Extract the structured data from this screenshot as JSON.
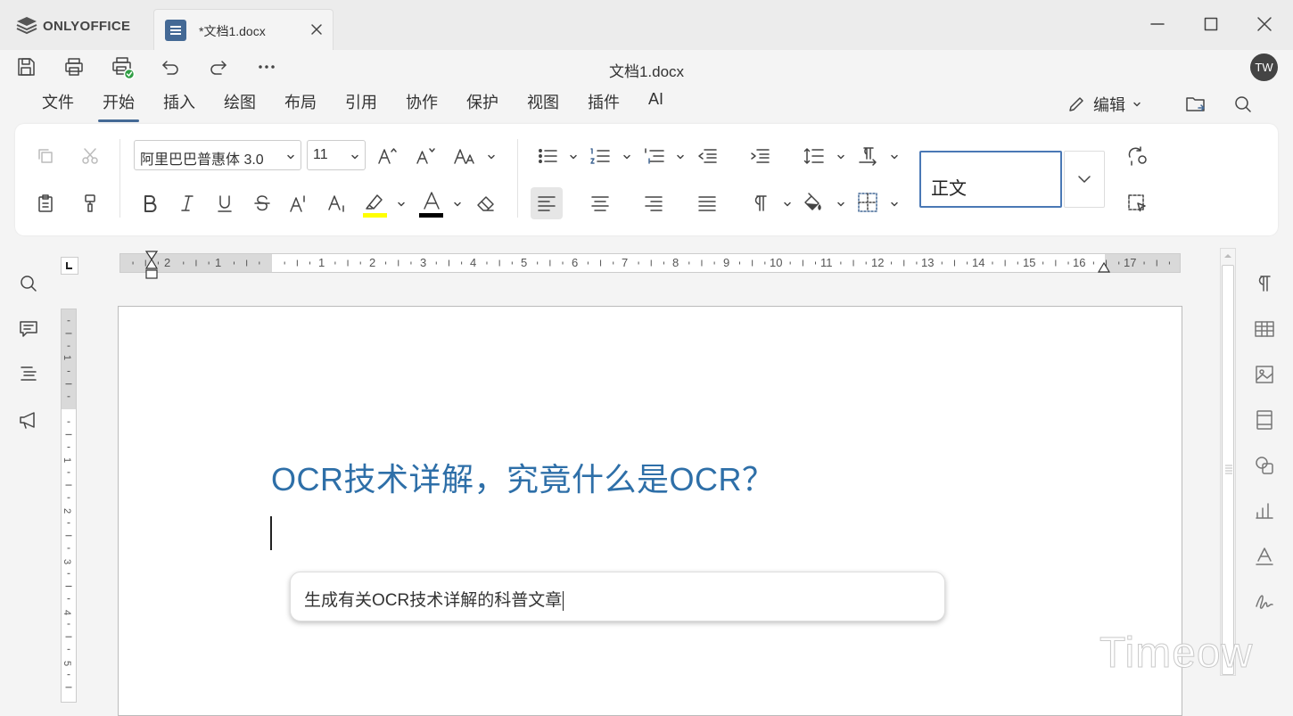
{
  "app": {
    "name": "ONLYOFFICE"
  },
  "tab": {
    "title": "*文档1.docx"
  },
  "document": {
    "title": "文档1.docx"
  },
  "user": {
    "initials": "TW"
  },
  "menu": {
    "tabs": [
      "文件",
      "开始",
      "插入",
      "绘图",
      "布局",
      "引用",
      "协作",
      "保护",
      "视图",
      "插件",
      "AI"
    ],
    "active": "开始"
  },
  "mode": {
    "label": "编辑"
  },
  "toolbar": {
    "font_name": "阿里巴巴普惠体 3.0",
    "font_size": "11",
    "style": "正文",
    "highlight_color": "#ffff00",
    "font_color": "#000000"
  },
  "ruler": {
    "horizontal_labels": [
      "2",
      "1",
      "1",
      "2",
      "3",
      "4",
      "5",
      "6",
      "7",
      "8",
      "9",
      "10",
      "11",
      "12",
      "13",
      "14",
      "15",
      "16",
      "17"
    ],
    "vertical_labels": [
      "1",
      "1",
      "2",
      "3",
      "4",
      "5"
    ]
  },
  "content": {
    "heading": "OCR技术详解，究竟什么是OCR？",
    "ai_prompt": "生成有关OCR技术详解的科普文章"
  },
  "watermark": {
    "text": "Timeow"
  },
  "colors": {
    "accent": "#446995",
    "heading": "#2e6fa8",
    "style_border": "#4a78b5"
  }
}
